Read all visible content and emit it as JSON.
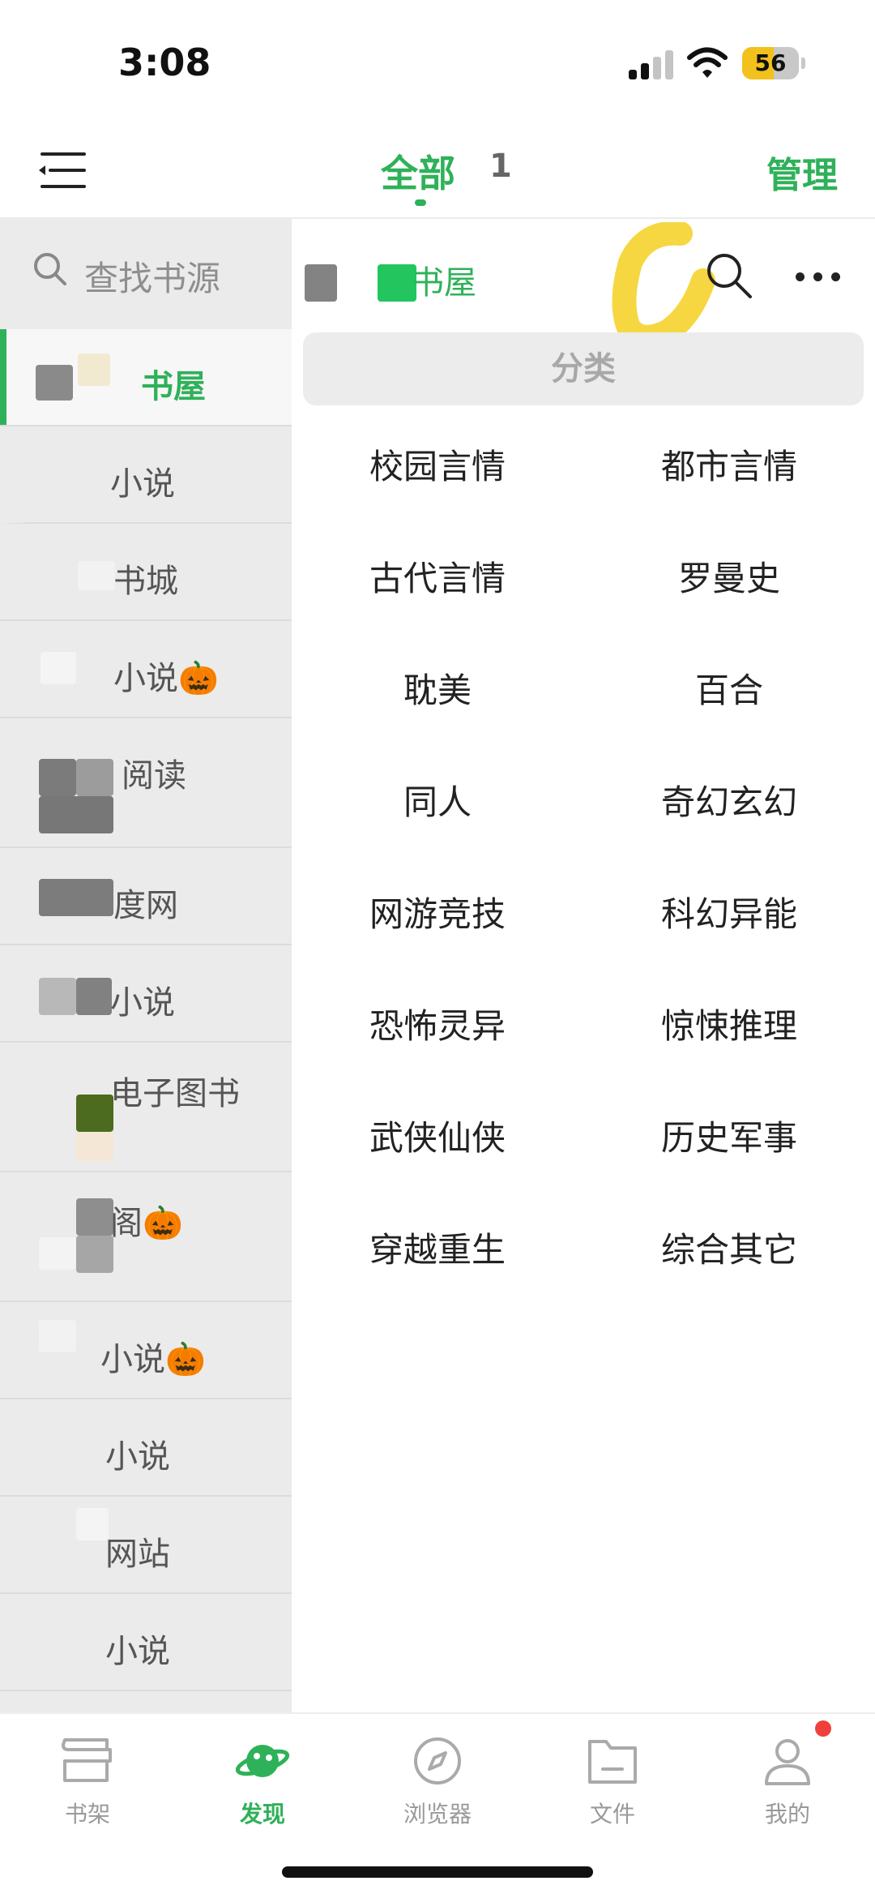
{
  "status": {
    "time": "3:08",
    "battery": "56",
    "battery_level": 0.56
  },
  "header": {
    "tab_label": "全部",
    "tab_count": "1",
    "manage_label": "管理"
  },
  "sidebar": {
    "search_placeholder": "查找书源",
    "items": [
      {
        "label": "书屋",
        "active": true
      },
      {
        "label": "小说"
      },
      {
        "label": "书城"
      },
      {
        "label": "小说🎃"
      },
      {
        "label": "阅读"
      },
      {
        "label": "度网"
      },
      {
        "label": "小说"
      },
      {
        "label": "电子图书"
      },
      {
        "label": "阁🎃"
      },
      {
        "label": "小说🎃"
      },
      {
        "label": "小说"
      },
      {
        "label": "网站"
      },
      {
        "label": "小说"
      }
    ]
  },
  "main": {
    "source_title": "书屋",
    "section_label": "分类",
    "categories": [
      "校园言情",
      "都市言情",
      "古代言情",
      "罗曼史",
      "耽美",
      "百合",
      "同人",
      "奇幻玄幻",
      "网游竞技",
      "科幻异能",
      "恐怖灵异",
      "惊悚推理",
      "武侠仙侠",
      "历史军事",
      "穿越重生",
      "综合其它"
    ]
  },
  "bottom_nav": {
    "items": [
      {
        "label": "书架",
        "icon": "bookshelf-icon"
      },
      {
        "label": "发现",
        "icon": "planet-icon",
        "active": true
      },
      {
        "label": "浏览器",
        "icon": "compass-icon"
      },
      {
        "label": "文件",
        "icon": "folder-icon"
      },
      {
        "label": "我的",
        "icon": "person-icon"
      }
    ]
  },
  "colors": {
    "accent": "#2fb159",
    "highlight": "#f5d020",
    "badge": "#f0403c"
  }
}
